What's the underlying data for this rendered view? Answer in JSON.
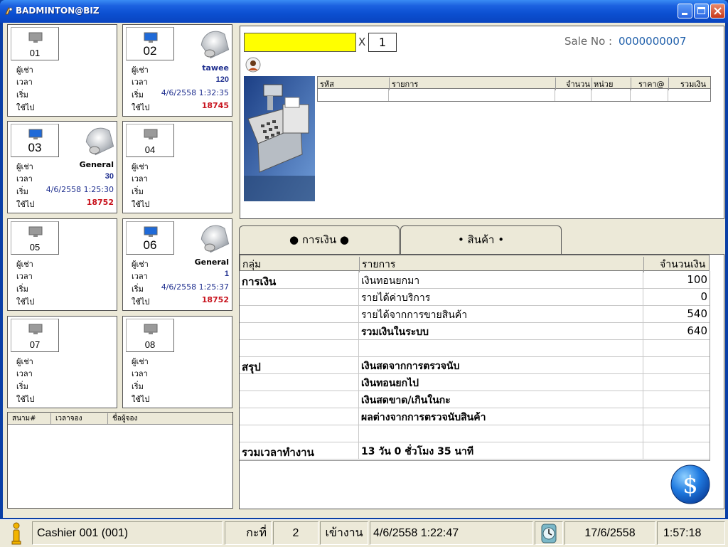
{
  "window": {
    "title": "BADMINTON@BIZ"
  },
  "courts": [
    {
      "number": "01",
      "labels": {
        "renter": "ผู้เช่า",
        "time": "เวลา",
        "start": "เริ่ม",
        "used": "ใช้ไป"
      },
      "active": false
    },
    {
      "number": "02",
      "labels": {
        "renter": "ผู้เช่า",
        "time": "เวลา",
        "start": "เริ่ม",
        "used": "ใช้ไป"
      },
      "active": true,
      "renter": "tawee",
      "time": "120",
      "start": "4/6/2558 1:32:35",
      "used": "18745"
    },
    {
      "number": "03",
      "labels": {
        "renter": "ผู้เช่า",
        "time": "เวลา",
        "start": "เริ่ม",
        "used": "ใช้ไป"
      },
      "active": true,
      "renter": "General",
      "time": "30",
      "start": "4/6/2558 1:25:30",
      "used": "18752"
    },
    {
      "number": "04",
      "labels": {
        "renter": "ผู้เช่า",
        "time": "เวลา",
        "start": "เริ่ม",
        "used": "ใช้ไป"
      },
      "active": false
    },
    {
      "number": "05",
      "labels": {
        "renter": "ผู้เช่า",
        "time": "เวลา",
        "start": "เริ่ม",
        "used": "ใช้ไป"
      },
      "active": false
    },
    {
      "number": "06",
      "labels": {
        "renter": "ผู้เช่า",
        "time": "เวลา",
        "start": "เริ่ม",
        "used": "ใช้ไป"
      },
      "active": true,
      "renter": "General",
      "time": "1",
      "start": "4/6/2558 1:25:37",
      "used": "18752"
    },
    {
      "number": "07",
      "labels": {
        "renter": "ผู้เช่า",
        "time": "เวลา",
        "start": "เริ่ม",
        "used": "ใช้ไป"
      },
      "active": false
    },
    {
      "number": "08",
      "labels": {
        "renter": "ผู้เช่า",
        "time": "เวลา",
        "start": "เริ่ม",
        "used": "ใช้ไป"
      },
      "active": false
    }
  ],
  "booking": {
    "columns": [
      "สนาม#",
      "เวลาจอง",
      "ชื่อผู้จอง"
    ]
  },
  "sale": {
    "code_input": "",
    "multiply": "X",
    "quantity": "1",
    "sale_no_label": "Sale No :",
    "sale_no": "0000000007",
    "columns": [
      "รหัส",
      "รายการ",
      "จำนวน",
      "หน่วย",
      "ราคา@",
      "รวมเงิน"
    ]
  },
  "tabs": [
    {
      "label": "● การเงิน ●",
      "active": true
    },
    {
      "label": "• สินค้า •",
      "active": false
    }
  ],
  "summary": {
    "columns": [
      "กลุ่ม",
      "รายการ",
      "จำนวนเงิน"
    ],
    "rows": [
      {
        "group": "การเงิน",
        "item": "เงินทอนยกมา",
        "amount": "100"
      },
      {
        "group": "",
        "item": "รายได้ค่าบริการ",
        "amount": "0"
      },
      {
        "group": "",
        "item": "รายได้จากการขายสินค้า",
        "amount": "540"
      },
      {
        "group": "",
        "item": "รวมเงินในระบบ",
        "amount": "640"
      },
      {
        "group": "",
        "item": "",
        "amount": ""
      },
      {
        "group": "สรุป",
        "item": "เงินสดจากการตรวจนับ",
        "amount": ""
      },
      {
        "group": "",
        "item": "เงินทอนยกไป",
        "amount": ""
      },
      {
        "group": "",
        "item": "เงินสดขาด/เกินในกะ",
        "amount": ""
      },
      {
        "group": "",
        "item": "ผลต่างจากการตรวจนับสินค้า",
        "amount": ""
      },
      {
        "group": "",
        "item": "",
        "amount": ""
      },
      {
        "group": "รวมเวลาทำงาน",
        "item": "13 วัน 0 ชั่วโมง 35 นาที",
        "amount": ""
      }
    ]
  },
  "status": {
    "cashier": "Cashier 001 (001)",
    "shift_label": "กะที่",
    "shift": "2",
    "login_label": "เข้างาน",
    "login_time": "4/6/2558 1:22:47",
    "date": "17/6/2558",
    "time": "1:57:18"
  },
  "colors": {
    "titlebar": "#0b4fd1",
    "input_highlight": "#ffff00",
    "used_red": "#c8141e",
    "value_blue": "#1f2f8f"
  }
}
